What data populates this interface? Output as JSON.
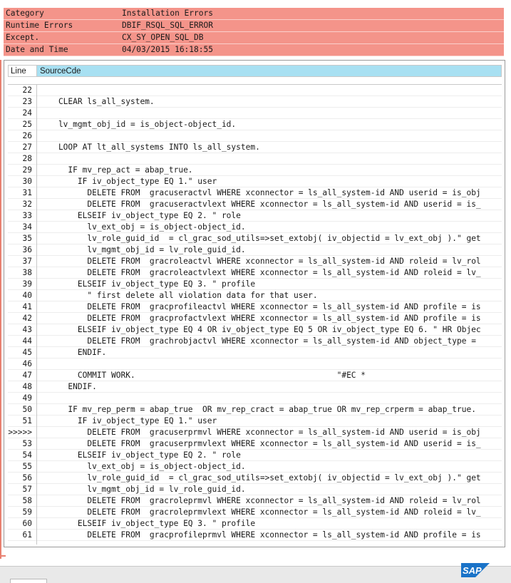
{
  "header": {
    "rows": [
      {
        "label": "Category",
        "value": "Installation Errors"
      },
      {
        "label": "Runtime Errors",
        "value": "DBIF_RSQL_SQL_ERROR"
      },
      {
        "label": "Except.",
        "value": "CX_SY_OPEN_SQL_DB"
      },
      {
        "label": "Date and Time",
        "value": "04/03/2015 16:18:55"
      }
    ]
  },
  "source_table": {
    "col_line": "Line",
    "col_source": "SourceCde",
    "rows": [
      {
        "ln": "22",
        "code": ""
      },
      {
        "ln": "23",
        "code": "    CLEAR ls_all_system."
      },
      {
        "ln": "24",
        "code": ""
      },
      {
        "ln": "25",
        "code": "    lv_mgmt_obj_id = is_object-object_id."
      },
      {
        "ln": "26",
        "code": ""
      },
      {
        "ln": "27",
        "code": "    LOOP AT lt_all_systems INTO ls_all_system."
      },
      {
        "ln": "28",
        "code": ""
      },
      {
        "ln": "29",
        "code": "      IF mv_rep_act = abap_true."
      },
      {
        "ln": "30",
        "code": "        IF iv_object_type EQ 1.\" user"
      },
      {
        "ln": "31",
        "code": "          DELETE FROM  gracuseractvl WHERE xconnector = ls_all_system-id AND userid = is_obj"
      },
      {
        "ln": "32",
        "code": "          DELETE FROM  gracuseractvlext WHERE xconnector = ls_all_system-id AND userid = is_"
      },
      {
        "ln": "33",
        "code": "        ELSEIF iv_object_type EQ 2. \" role"
      },
      {
        "ln": "34",
        "code": "          lv_ext_obj = is_object-object_id."
      },
      {
        "ln": "35",
        "code": "          lv_role_guid_id  = cl_grac_sod_utils=>set_extobj( iv_objectid = lv_ext_obj ).\" get"
      },
      {
        "ln": "36",
        "code": "          lv_mgmt_obj_id = lv_role_guid_id."
      },
      {
        "ln": "37",
        "code": "          DELETE FROM  gracroleactvl WHERE xconnector = ls_all_system-id AND roleid = lv_rol"
      },
      {
        "ln": "38",
        "code": "          DELETE FROM  gracroleactvlext WHERE xconnector = ls_all_system-id AND roleid = lv_"
      },
      {
        "ln": "39",
        "code": "        ELSEIF iv_object_type EQ 3. \" profile"
      },
      {
        "ln": "40",
        "code": "          \" first delete all violation data for that user."
      },
      {
        "ln": "41",
        "code": "          DELETE FROM  gracprofileactvl WHERE xconnector = ls_all_system-id AND profile = is"
      },
      {
        "ln": "42",
        "code": "          DELETE FROM  gracprofactvlext WHERE xconnector = ls_all_system-id AND profile = is"
      },
      {
        "ln": "43",
        "code": "        ELSEIF iv_object_type EQ 4 OR iv_object_type EQ 5 OR iv_object_type EQ 6. \" HR Objec"
      },
      {
        "ln": "44",
        "code": "          DELETE FROM  grachrobjactvl WHERE xconnector = ls_all_system-id AND object_type ="
      },
      {
        "ln": "45",
        "code": "        ENDIF."
      },
      {
        "ln": "46",
        "code": ""
      },
      {
        "ln": "47",
        "code": "        COMMIT WORK.                                          \"#EC *"
      },
      {
        "ln": "48",
        "code": "      ENDIF."
      },
      {
        "ln": "49",
        "code": ""
      },
      {
        "ln": "50",
        "code": "      IF mv_rep_perm = abap_true  OR mv_rep_cract = abap_true OR mv_rep_crperm = abap_true."
      },
      {
        "ln": "51",
        "code": "        IF iv_object_type EQ 1.\" user"
      },
      {
        "ln": ">>>>>",
        "code": "          DELETE FROM  gracuserprmvl WHERE xconnector = ls_all_system-id AND userid = is_obj"
      },
      {
        "ln": "53",
        "code": "          DELETE FROM  gracuserprmvlext WHERE xconnector = ls_all_system-id AND userid = is_"
      },
      {
        "ln": "54",
        "code": "        ELSEIF iv_object_type EQ 2. \" role"
      },
      {
        "ln": "55",
        "code": "          lv_ext_obj = is_object-object_id."
      },
      {
        "ln": "56",
        "code": "          lv_role_guid_id  = cl_grac_sod_utils=>set_extobj( iv_objectid = lv_ext_obj ).\" get"
      },
      {
        "ln": "57",
        "code": "          lv_mgmt_obj_id = lv_role_guid_id."
      },
      {
        "ln": "58",
        "code": "          DELETE FROM  gracroleprmvl WHERE xconnector = ls_all_system-id AND roleid = lv_rol"
      },
      {
        "ln": "59",
        "code": "          DELETE FROM  gracroleprmvlext WHERE xconnector = ls_all_system-id AND roleid = lv_"
      },
      {
        "ln": "60",
        "code": "        ELSEIF iv_object_type EQ 3. \" profile"
      },
      {
        "ln": "61",
        "code": "          DELETE FROM  gracprofileprmvl WHERE xconnector = ls_all_system-id AND profile = is"
      }
    ]
  },
  "footer": {
    "logo_text": "SAP"
  }
}
